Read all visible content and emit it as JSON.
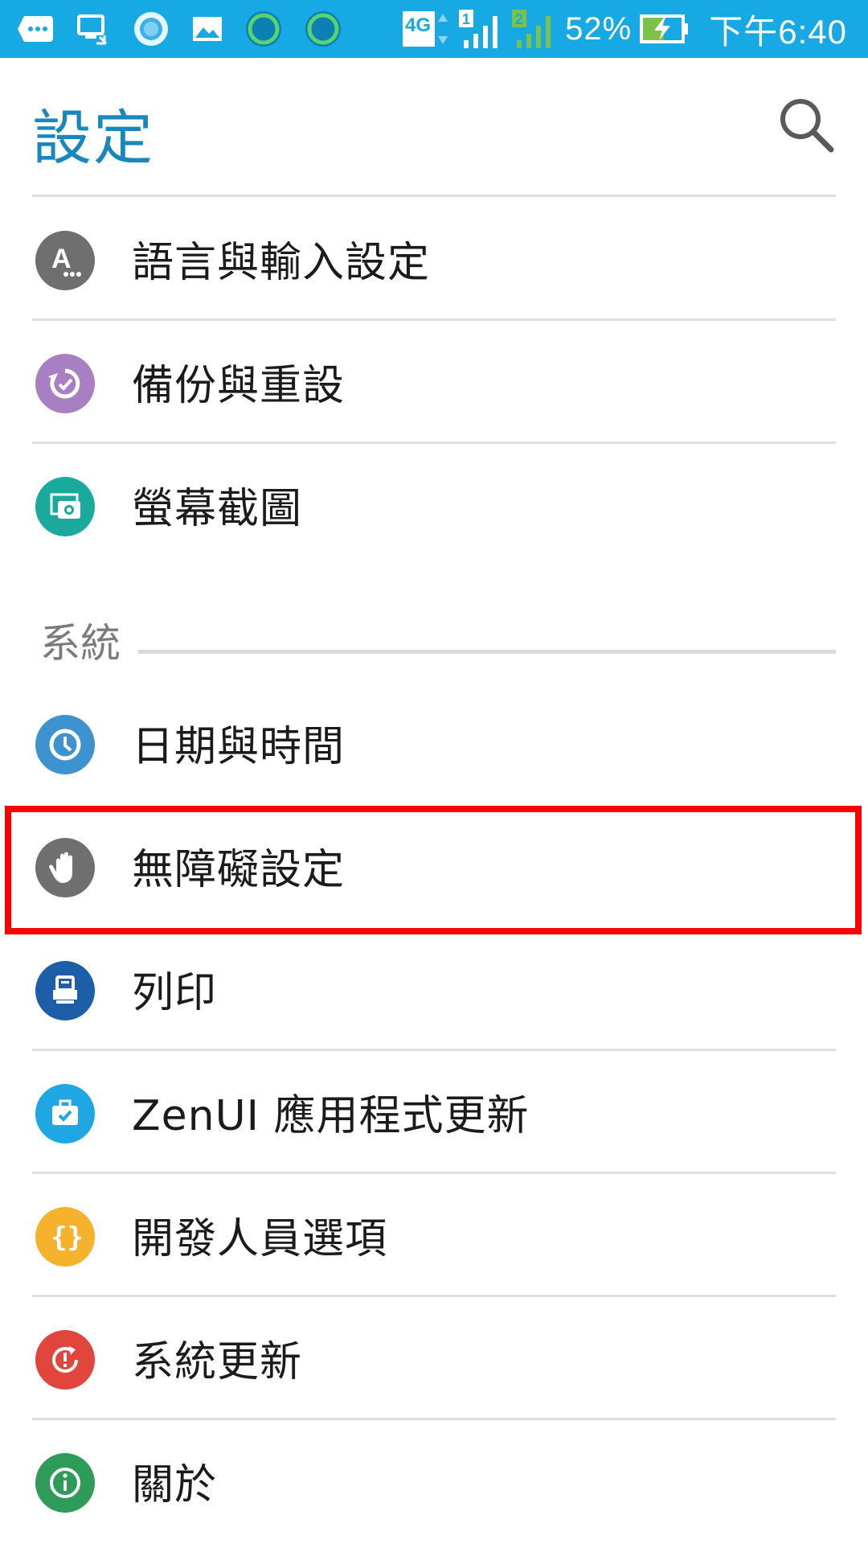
{
  "status_bar": {
    "network": "4G",
    "sim1": "1",
    "sim2": "2",
    "battery": "52%",
    "time": "下午6:40",
    "icons": [
      "more-icon",
      "screen-cast-icon",
      "assistant-icon",
      "gallery-icon",
      "circle-app-icon",
      "circle-app-icon"
    ]
  },
  "header": {
    "title": "設定",
    "search_icon": "search-icon"
  },
  "items_top": [
    {
      "label": "語言與輸入設定",
      "icon": "language-icon",
      "color": "#6f6f6f"
    },
    {
      "label": "備份與重設",
      "icon": "backup-icon",
      "color": "#a97fc4"
    },
    {
      "label": "螢幕截圖",
      "icon": "screenshot-icon",
      "color": "#19a99d"
    }
  ],
  "section": {
    "label": "系統"
  },
  "items_system": [
    {
      "label": "日期與時間",
      "icon": "clock-icon",
      "color": "#3d93cf"
    },
    {
      "label": "無障礙設定",
      "icon": "hand-icon",
      "color": "#6f6f6f",
      "highlighted": true
    },
    {
      "label": "列印",
      "icon": "print-icon",
      "color": "#1d5ea8"
    },
    {
      "label": "ZenUI 應用程式更新",
      "icon": "briefcase-icon",
      "color": "#1ea7e3"
    },
    {
      "label": "開發人員選項",
      "icon": "braces-icon",
      "color": "#f5b22d"
    },
    {
      "label": "系統更新",
      "icon": "update-icon",
      "color": "#e2453b"
    },
    {
      "label": "關於",
      "icon": "info-icon",
      "color": "#2e9b58"
    }
  ]
}
